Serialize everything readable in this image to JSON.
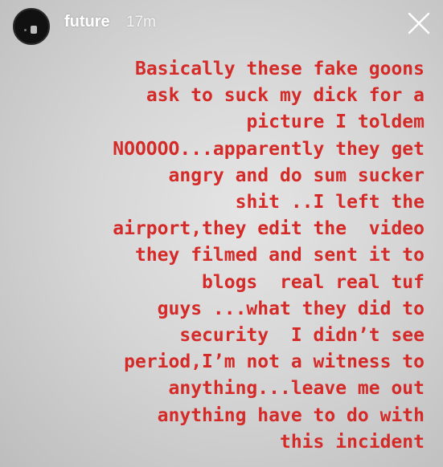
{
  "header": {
    "username": "future",
    "timestamp": "17m"
  },
  "caption": {
    "color": "#d42a28",
    "lines": [
      "Basically these fake goons",
      "ask to suck my dick for a",
      "picture I toldem",
      "NOOOOO...apparently they get",
      "angry and do sum sucker",
      "shit ..I left the",
      "airport,they edit the  video",
      "they filmed and sent it to",
      "blogs  real real tuf",
      "guys ...what they did to",
      "security  I didn’t see",
      "period,I’m not a witness to",
      "anything...leave me out",
      "anything have to do with",
      "this incident"
    ]
  },
  "icons": {
    "close": "close-icon",
    "avatar": "avatar"
  }
}
